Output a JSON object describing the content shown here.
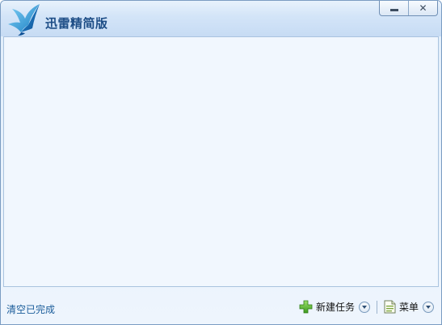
{
  "window": {
    "title": "迅雷精简版"
  },
  "footer": {
    "clear_completed": "清空已完成",
    "new_task_label": "新建任务",
    "menu_label": "菜单"
  },
  "icons": {
    "logo": "bird-logo-icon",
    "minimize": "minimize-icon",
    "close": "close-icon",
    "new_task": "green-plus-icon",
    "menu": "document-icon",
    "dropdown": "chevron-down-icon"
  },
  "colors": {
    "title_text": "#1d4d86",
    "link_text": "#1a5c9a",
    "window_border": "#7a9cc2",
    "content_bg": "#f1f7fe"
  }
}
